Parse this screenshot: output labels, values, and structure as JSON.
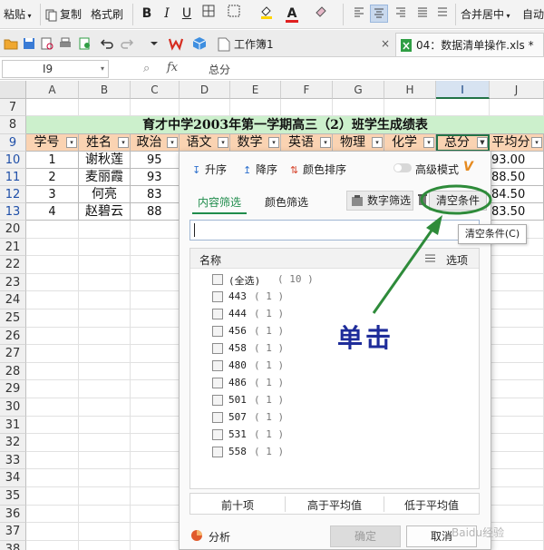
{
  "ribbon": {
    "paste": "粘贴",
    "copy": "复制",
    "format_painter": "格式刷",
    "bold": "B",
    "italic": "I",
    "underline": "U",
    "font_color_letter": "A",
    "merge_center": "合并居中",
    "auto": "自动"
  },
  "tabs": {
    "workbook": "工作簿1",
    "file": "04：数据清单操作.xls *",
    "close": "×"
  },
  "formula_bar": {
    "cell_ref": "I9",
    "fx": "fx",
    "content": "总分"
  },
  "sheet": {
    "columns": [
      "A",
      "B",
      "C",
      "D",
      "E",
      "F",
      "G",
      "H",
      "I",
      "J"
    ],
    "selected_column": "I",
    "rows": [
      {
        "n": "7",
        "blue": false
      },
      {
        "n": "8",
        "blue": false
      },
      {
        "n": "9",
        "blue": true
      },
      {
        "n": "10",
        "blue": true
      },
      {
        "n": "11",
        "blue": true
      },
      {
        "n": "12",
        "blue": true
      },
      {
        "n": "13",
        "blue": true
      },
      {
        "n": "20",
        "blue": false
      },
      {
        "n": "21",
        "blue": false
      },
      {
        "n": "22",
        "blue": false
      },
      {
        "n": "23",
        "blue": false
      },
      {
        "n": "24",
        "blue": false
      },
      {
        "n": "25",
        "blue": false
      },
      {
        "n": "26",
        "blue": false
      },
      {
        "n": "27",
        "blue": false
      },
      {
        "n": "28",
        "blue": false
      },
      {
        "n": "29",
        "blue": false
      },
      {
        "n": "30",
        "blue": false
      },
      {
        "n": "31",
        "blue": false
      },
      {
        "n": "32",
        "blue": false
      },
      {
        "n": "33",
        "blue": false
      },
      {
        "n": "34",
        "blue": false
      },
      {
        "n": "35",
        "blue": false
      },
      {
        "n": "36",
        "blue": false
      },
      {
        "n": "37",
        "blue": false
      },
      {
        "n": "38",
        "blue": false
      }
    ],
    "title": "育才中学2003年第一学期高三（2）班学生成绩表",
    "headers": [
      "学号",
      "姓名",
      "政治",
      "语文",
      "数学",
      "英语",
      "物理",
      "化学",
      "总分",
      "平均分"
    ],
    "data": [
      {
        "id": "1",
        "name": "谢秋莲",
        "politics": "95",
        "avg": "93.00"
      },
      {
        "id": "2",
        "name": "麦丽霞",
        "politics": "93",
        "avg": "88.50"
      },
      {
        "id": "3",
        "name": "何亮",
        "politics": "83",
        "avg": "84.50"
      },
      {
        "id": "4",
        "name": "赵碧云",
        "politics": "88",
        "avg": "83.50"
      }
    ]
  },
  "filter_panel": {
    "sort_asc": "升序",
    "sort_desc": "降序",
    "sort_color": "颜色排序",
    "advanced_mode": "高级模式",
    "advanced_badge": "V",
    "tab_content": "内容筛选",
    "tab_color": "颜色筛选",
    "number_filter": "数字筛选",
    "clear_condition": "清空条件",
    "list_header_name": "名称",
    "list_header_options": "选项",
    "items": [
      {
        "label": "(全选)",
        "count": "( 10 )"
      },
      {
        "label": "443",
        "count": "( 1 )"
      },
      {
        "label": "444",
        "count": "( 1 )"
      },
      {
        "label": "456",
        "count": "( 1 )"
      },
      {
        "label": "458",
        "count": "( 1 )"
      },
      {
        "label": "480",
        "count": "( 1 )"
      },
      {
        "label": "486",
        "count": "( 1 )"
      },
      {
        "label": "501",
        "count": "( 1 )"
      },
      {
        "label": "507",
        "count": "( 1 )"
      },
      {
        "label": "531",
        "count": "( 1 )"
      },
      {
        "label": "558",
        "count": "( 1 )"
      }
    ],
    "stats": [
      "前十项",
      "高于平均值",
      "低于平均值"
    ],
    "analysis": "分析",
    "ok": "确定",
    "cancel": "取消"
  },
  "tooltip": "清空条件(C)",
  "annotation": {
    "label": "单击",
    "color": "#1e2c9a",
    "arrow_color": "#2e8b3a"
  },
  "watermark": "Baidu经验",
  "colors": {
    "title_bg": "#ccf0cc",
    "header_bg": "#fad3b2",
    "accent_green": "#1f8c4c"
  }
}
